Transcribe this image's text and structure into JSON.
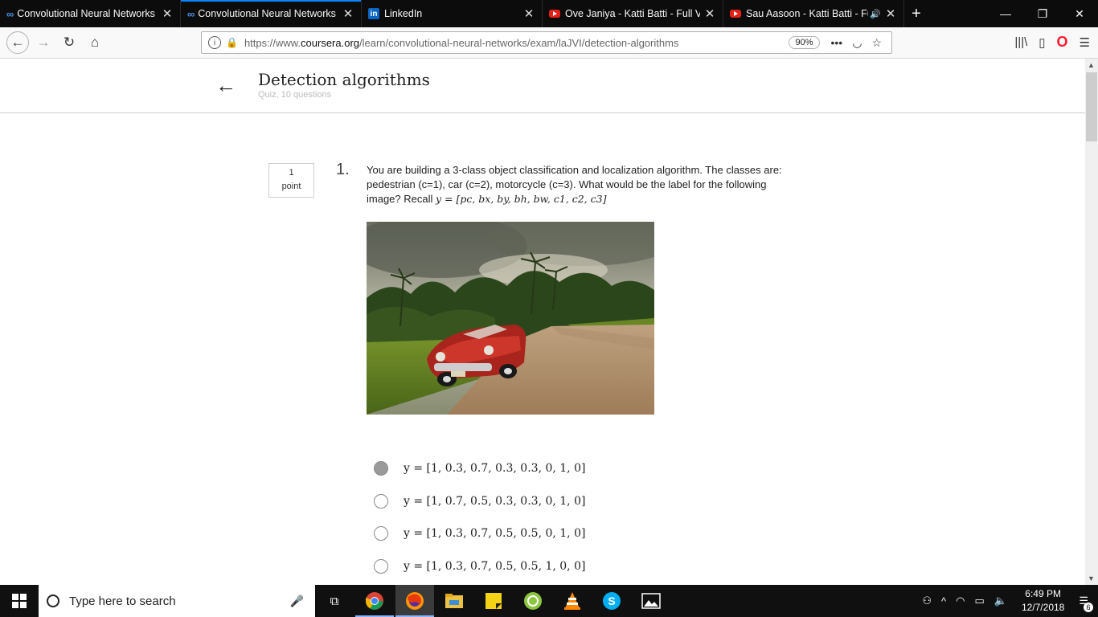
{
  "tabs": [
    {
      "title": "Convolutional Neural Networks",
      "favicon": "coursera-icon",
      "active": false,
      "speaker": false
    },
    {
      "title": "Convolutional Neural Networks",
      "favicon": "coursera-icon",
      "active": true,
      "speaker": false
    },
    {
      "title": "LinkedIn",
      "favicon": "linkedin-icon",
      "active": false,
      "speaker": false
    },
    {
      "title": "Ove Janiya - Katti Batti - Full Video",
      "favicon": "youtube-icon",
      "active": false,
      "speaker": false
    },
    {
      "title": "Sau Aasoon - Katti Batti - Full Video",
      "favicon": "youtube-icon",
      "active": false,
      "speaker": true
    }
  ],
  "nav": {
    "url_prefix": "https://www.",
    "url_domain": "coursera.org",
    "url_path": "/learn/convolutional-neural-networks/exam/laJVI/detection-algorithms",
    "zoom": "90%"
  },
  "quiz": {
    "title": "Detection algorithms",
    "subtitle": "Quiz, 10 questions"
  },
  "question": {
    "points_value": "1",
    "points_label": "point",
    "number": "1.",
    "text": "You are building a 3-class object classification and localization algorithm. The classes are: pedestrian (c=1), car (c=2), motorcycle (c=3). What would be the label for the following image? Recall ",
    "formula": "y = [pc, bx, by, bh, bw, c1, c2, c3]",
    "options": [
      {
        "label": "y = [1, 0.3, 0.7, 0.3, 0.3, 0, 1, 0]",
        "selected": true
      },
      {
        "label": "y = [1, 0.7, 0.5, 0.3, 0.3, 0, 1, 0]",
        "selected": false
      },
      {
        "label": "y = [1, 0.3, 0.7, 0.5, 0.5, 0, 1, 0]",
        "selected": false
      },
      {
        "label": "y = [1, 0.3, 0.7, 0.5, 0.5, 1, 0, 0]",
        "selected": false
      }
    ]
  },
  "taskbar": {
    "search_placeholder": "Type here to search",
    "time": "6:49 PM",
    "date": "12/7/2018",
    "notifications": "6"
  },
  "colors": {
    "tab_bg": "#0c0c0d",
    "active_tab_accent": "#0a84ff",
    "selected_radio": "#9a9a9a"
  }
}
